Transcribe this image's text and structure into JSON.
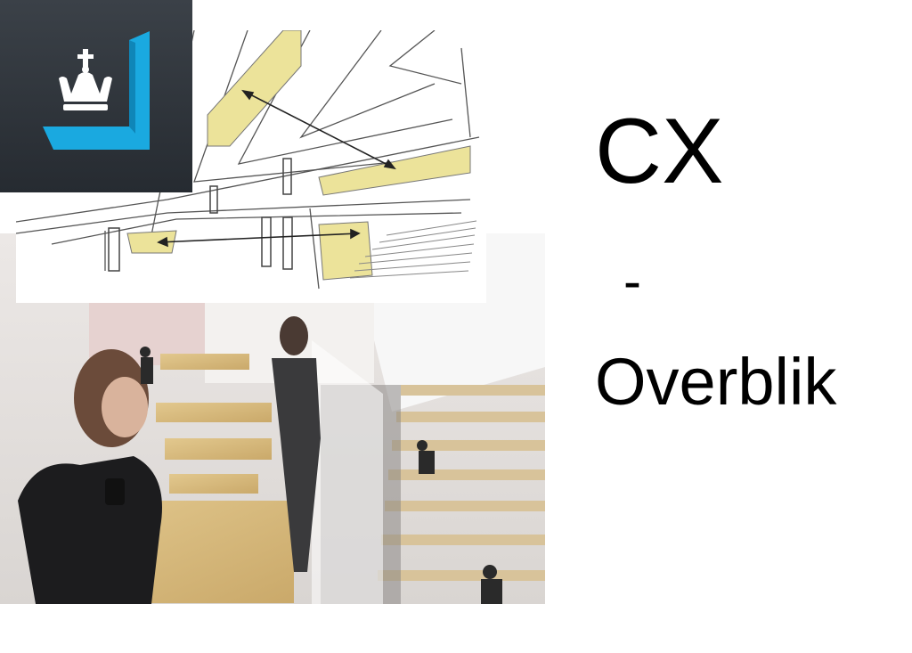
{
  "slide": {
    "title": "CX",
    "separator": "-",
    "subtitle": "Overblik"
  },
  "logo": {
    "icon": "crown-icon",
    "colors": {
      "tile": "#2e3339",
      "accent": "#1aa9e0",
      "crown": "#ffffff"
    }
  },
  "images": {
    "sketch": "architectural-sketch",
    "photo": "atrium-rendering"
  }
}
